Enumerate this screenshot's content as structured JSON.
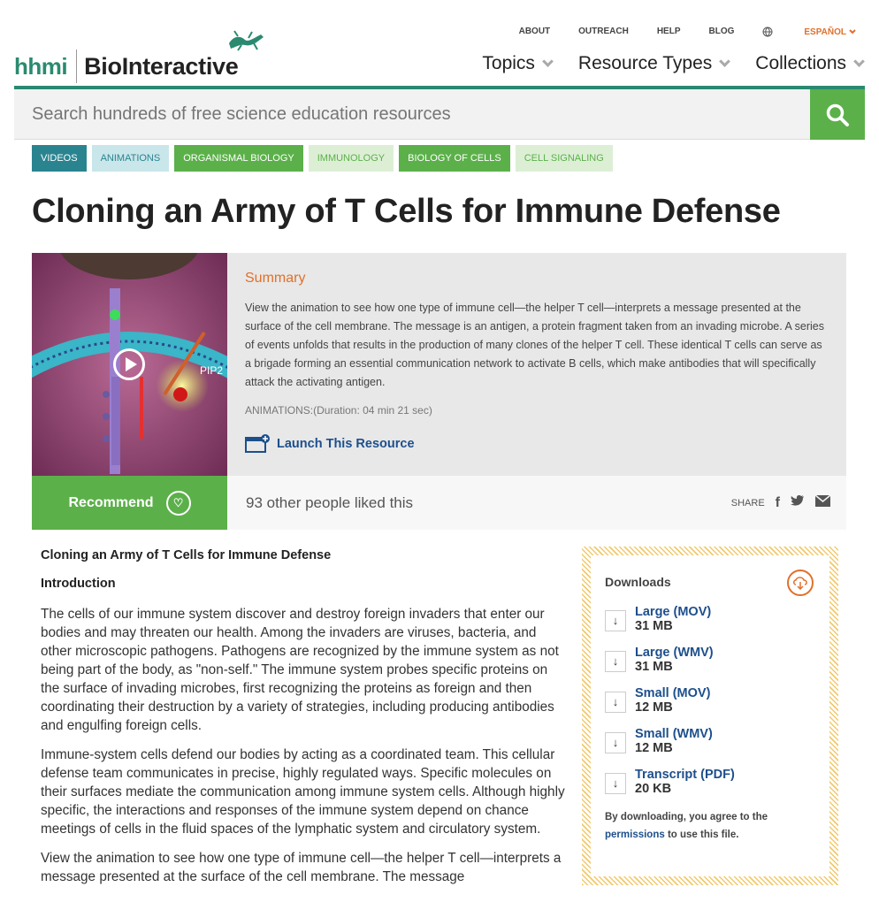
{
  "header": {
    "logo_hhmi": "hhmi",
    "logo_bio": "BioInteractive",
    "util_links": [
      "ABOUT",
      "OUTREACH",
      "HELP",
      "BLOG"
    ],
    "language": "ESPAÑOL",
    "nav": [
      "Topics",
      "Resource Types",
      "Collections"
    ]
  },
  "search": {
    "placeholder": "Search hundreds of free science education resources"
  },
  "tags": [
    "VIDEOS",
    "ANIMATIONS",
    "ORGANISMAL BIOLOGY",
    "IMMUNOLOGY",
    "BIOLOGY OF CELLS",
    "CELL SIGNALING"
  ],
  "page_title": "Cloning an Army of T Cells for Immune Defense",
  "thumbnail": {
    "label": "PIP2"
  },
  "summary": {
    "heading": "Summary",
    "text": "View the animation to see how one type of immune cell—the helper T cell—interprets a message presented at the surface of the cell membrane. The message is an antigen, a protein fragment taken from an invading microbe. A series of events unfolds that results in the production of many clones of the helper T cell. These identical T cells can serve as a brigade forming an essential communication network to activate B cells, which make antibodies that will specifically attack the activating antigen.",
    "duration": "ANIMATIONS:(Duration: 04 min 21 sec)",
    "launch": "Launch This Resource"
  },
  "recommend": {
    "label": "Recommend",
    "likes": "93 other people liked this",
    "share": "SHARE"
  },
  "article": {
    "title": "Cloning an Army of T Cells for Immune Defense",
    "section": "Introduction",
    "p1": "The cells of our immune system discover and destroy foreign invaders that enter our bodies and may threaten our health. Among the invaders are viruses, bacteria, and other microscopic pathogens. Pathogens are recognized by the immune system as not being part of the body, as \"non-self.\" The immune system probes specific proteins on the surface of invading microbes, first recognizing the proteins as foreign and then coordinating their destruction by a variety of strategies, including producing antibodies and engulfing foreign cells.",
    "p2": "Immune-system cells defend our bodies by acting as a coordinated team. This cellular defense team communicates in precise, highly regulated ways. Specific molecules on their surfaces mediate the communication among immune system cells. Although highly specific, the interactions and responses of the immune system depend on chance meetings of cells in the fluid spaces of the lymphatic system and circulatory system.",
    "p3": "View the animation to see how one type of immune cell—the helper T cell—interprets a message presented at the surface of the cell membrane. The message"
  },
  "downloads": {
    "heading": "Downloads",
    "items": [
      {
        "name": "Large (MOV)",
        "size": "31 MB"
      },
      {
        "name": "Large (WMV)",
        "size": "31 MB"
      },
      {
        "name": "Small (MOV)",
        "size": "12 MB"
      },
      {
        "name": "Small (WMV)",
        "size": "12 MB"
      },
      {
        "name": "Transcript (PDF)",
        "size": "20 KB"
      }
    ],
    "note_pre": "By downloading, you agree to the",
    "note_link": "permissions",
    "note_post": "to use this file."
  },
  "colors": {
    "brand_green": "#5cb04a",
    "teal": "#2a8490",
    "orange": "#e0702b",
    "link_blue": "#1d4f8c"
  }
}
